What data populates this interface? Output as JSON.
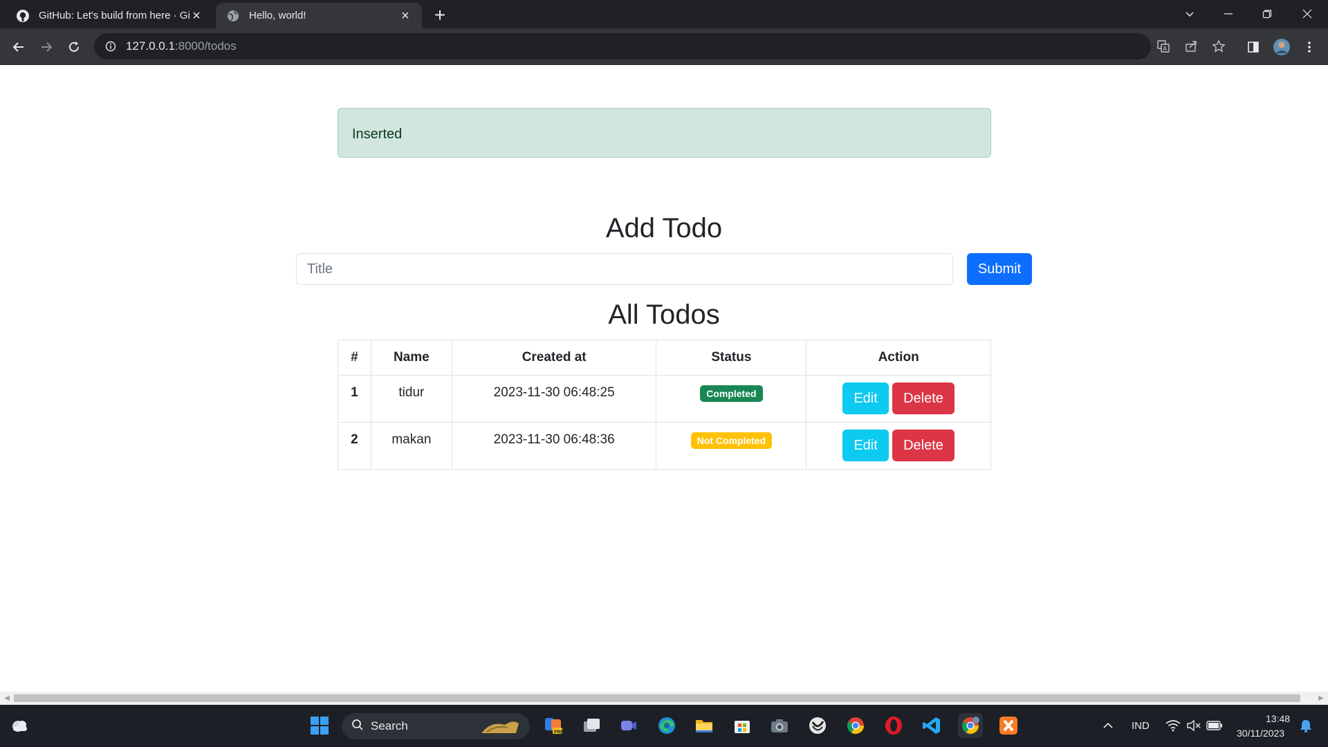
{
  "browser": {
    "tabs": [
      {
        "title": "GitHub: Let's build from here · GitHub",
        "active": false
      },
      {
        "title": "Hello, world!",
        "active": true
      }
    ],
    "url_host": "127.0.0.1",
    "url_rest": ":8000/todos"
  },
  "alert": {
    "text": "Inserted"
  },
  "form": {
    "heading": "Add Todo",
    "title_placeholder": "Title",
    "title_value": "",
    "submit_label": "Submit"
  },
  "list": {
    "heading": "All Todos",
    "columns": [
      "#",
      "Name",
      "Created at",
      "Status",
      "Action"
    ],
    "rows": [
      {
        "num": "1",
        "name": "tidur",
        "created_at": "2023-11-30 06:48:25",
        "status": "Completed",
        "edit": "Edit",
        "delete": "Delete"
      },
      {
        "num": "2",
        "name": "makan",
        "created_at": "2023-11-30 06:48:36",
        "status": "Not Completed",
        "edit": "Edit",
        "delete": "Delete"
      }
    ]
  },
  "taskbar": {
    "search_label": "Search",
    "language": "IND",
    "time": "13:48",
    "date": "30/11/2023"
  },
  "colors": {
    "primary": "#0d6efd",
    "success": "#198754",
    "warning": "#ffc107",
    "info": "#0dcaf0",
    "danger": "#dc3545",
    "alert_bg": "#d1e7dd"
  }
}
